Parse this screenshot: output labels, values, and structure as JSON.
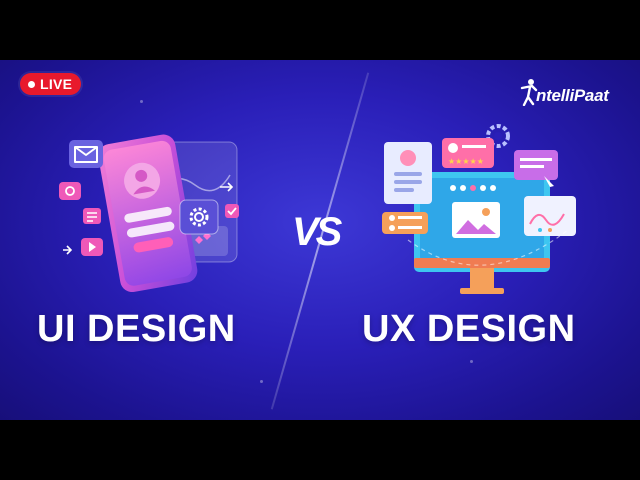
{
  "badge": {
    "label": "LIVE"
  },
  "logo": {
    "name": "ntelliPaat"
  },
  "titles": {
    "left": "UI DESIGN",
    "right": "UX DESIGN"
  },
  "vs": "VS",
  "icons": {
    "phone": "phone-ui-illustration",
    "monitor": "monitor-ux-illustration",
    "gear": "gear-icon",
    "mail": "mail-icon",
    "camera": "camera-icon",
    "play": "play-icon",
    "check": "check-icon",
    "profile": "profile-card-icon",
    "image": "image-icon",
    "chart": "chart-card-icon",
    "stars": "rating-stars-icon"
  },
  "colors": {
    "background": "#2a1fb8",
    "badge": "#e8192c",
    "phone_pink": "#e857c8",
    "phone_purple": "#8a4de8",
    "monitor_cyan": "#3ec6f0",
    "monitor_orange": "#f5a05a"
  }
}
